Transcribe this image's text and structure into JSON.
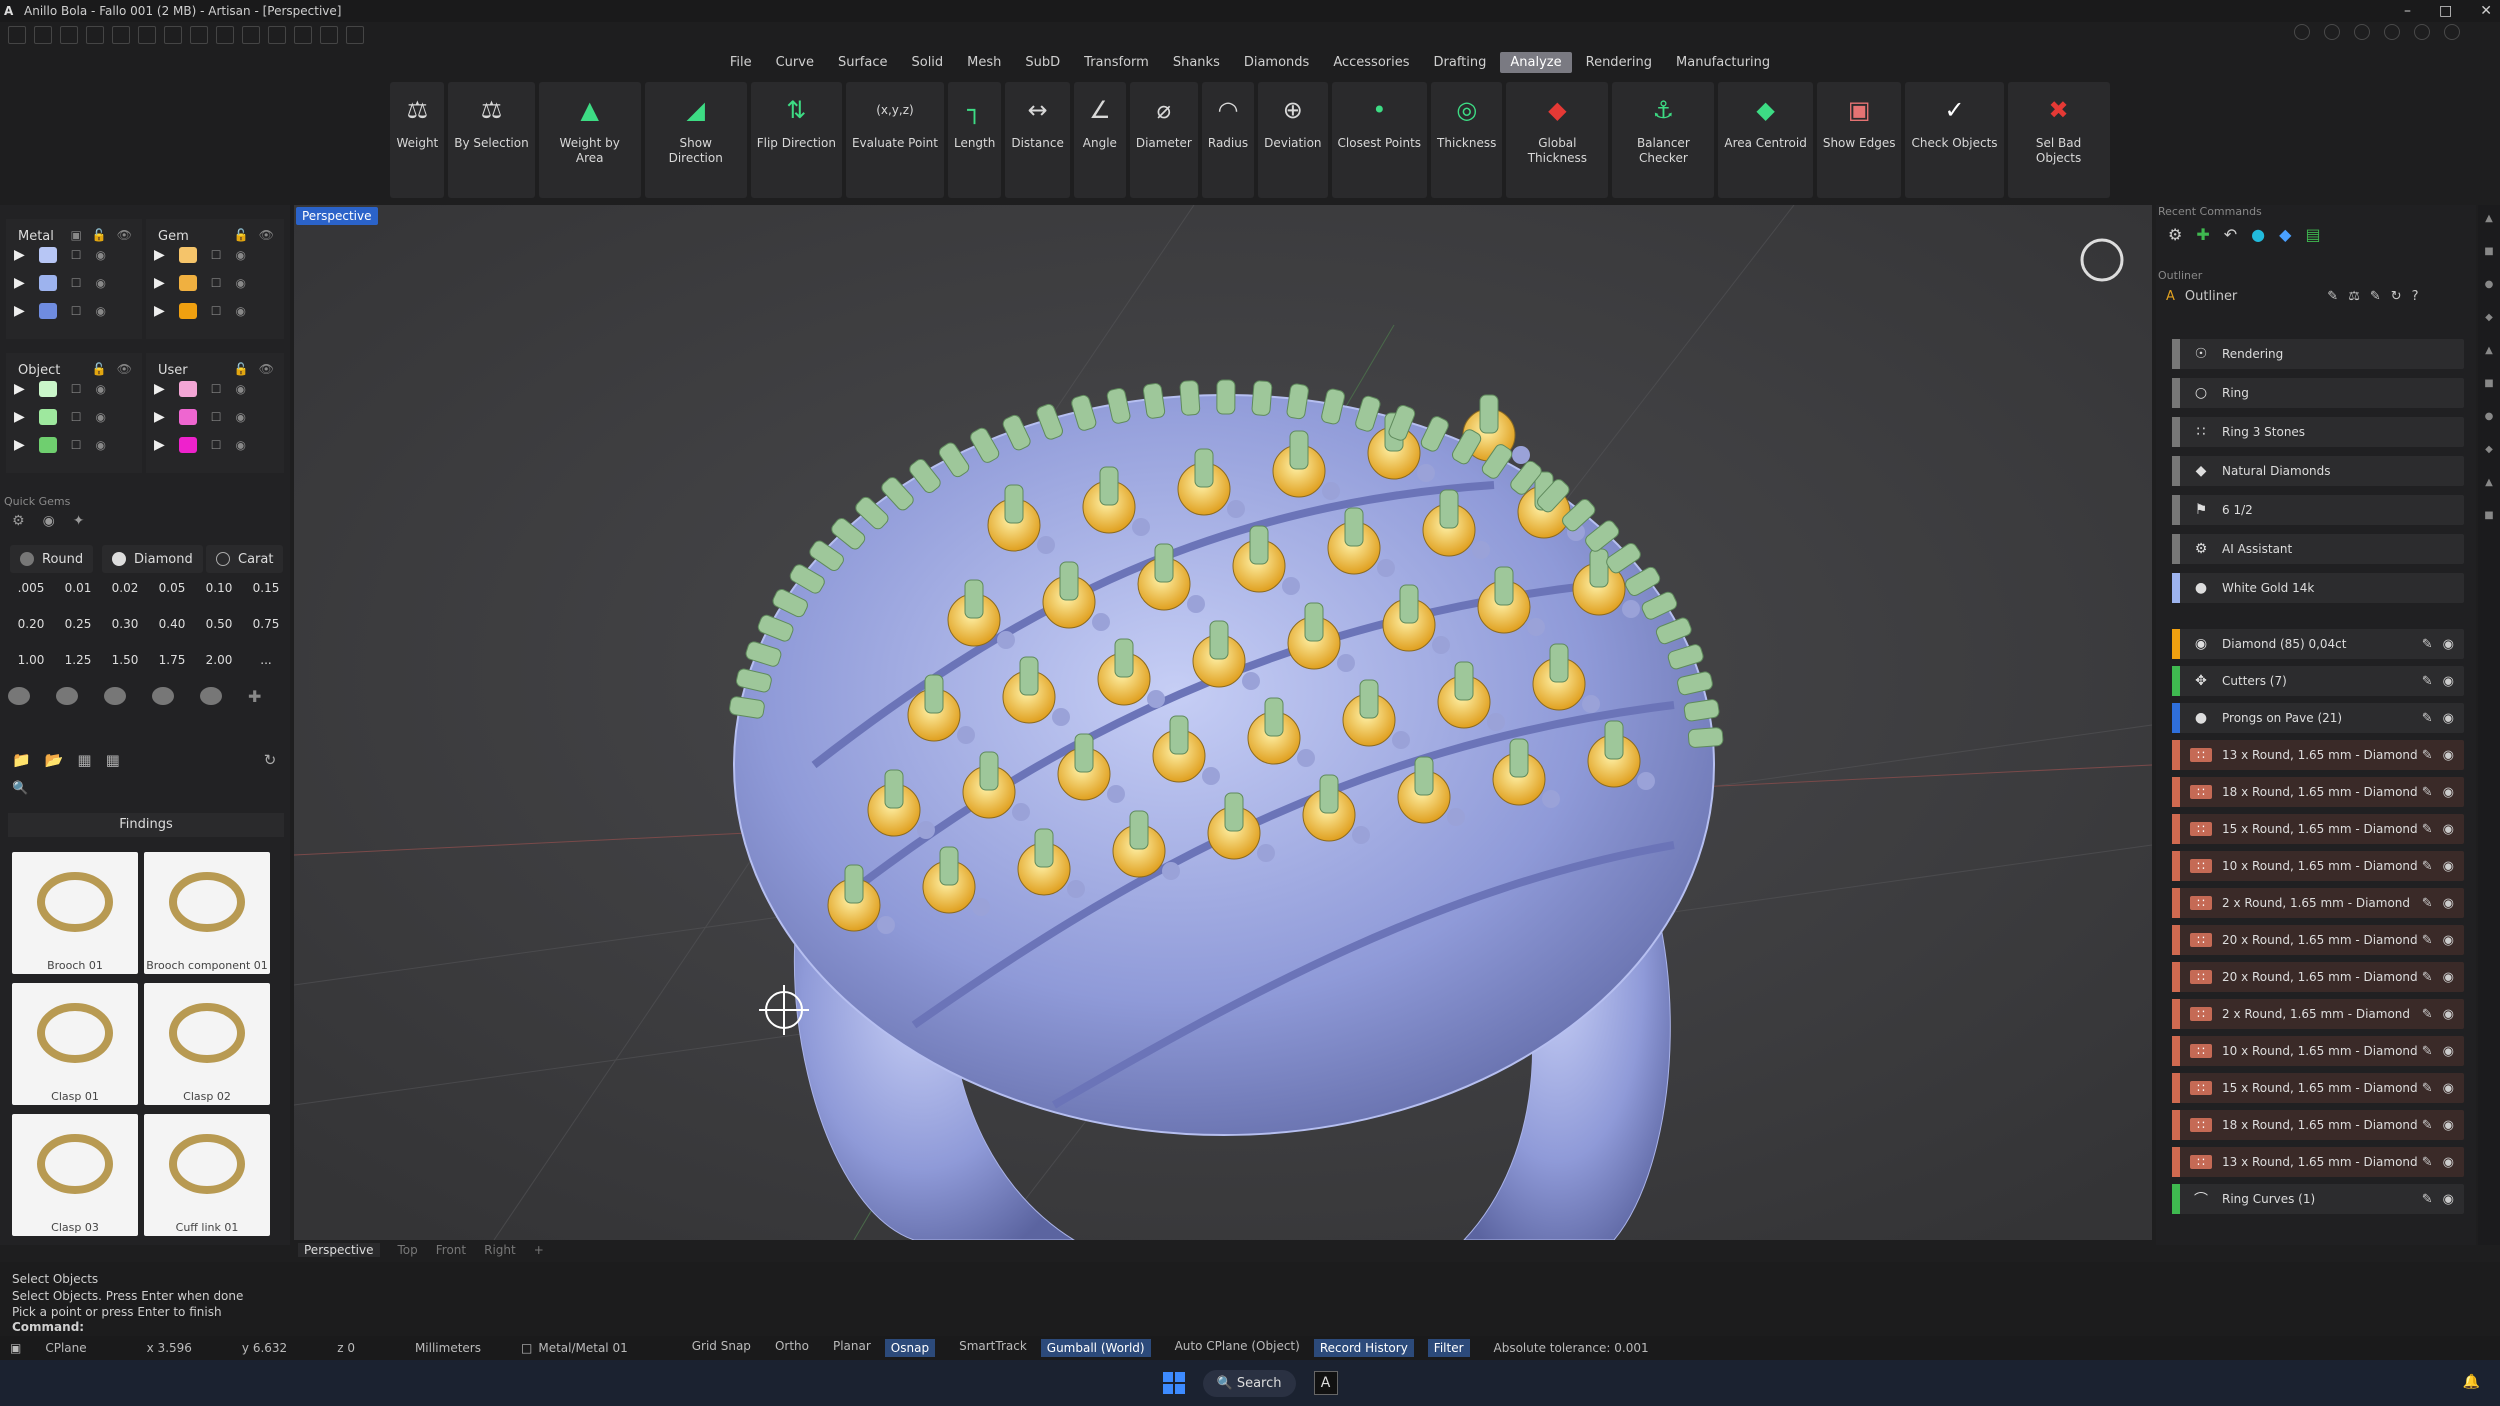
{
  "window": {
    "title": "Anillo Bola - Fallo 001 (2 MB) - Artisan - [Perspective]",
    "min": "–",
    "max": "□",
    "close": "✕"
  },
  "menu": [
    "File",
    "Curve",
    "Surface",
    "Solid",
    "Mesh",
    "SubD",
    "Transform",
    "Shanks",
    "Diamonds",
    "Accessories",
    "Drafting",
    "Analyze",
    "Rendering",
    "Manufacturing"
  ],
  "menu_active": "Analyze",
  "ribbon": [
    {
      "label": "Weight",
      "icon": "⚖",
      "color": "#d8d8d8"
    },
    {
      "label": "By Selection",
      "icon": "⚖",
      "color": "#d8d8d8"
    },
    {
      "label": "Weight by Area",
      "icon": "▲",
      "color": "#3ddc84"
    },
    {
      "label": "Show Direction",
      "icon": "◢",
      "color": "#3ddc84"
    },
    {
      "label": "Flip Direction",
      "icon": "⇅",
      "color": "#3ddc84"
    },
    {
      "label": "Evaluate Point",
      "icon": "(x,y,z)",
      "color": "#d8d8d8"
    },
    {
      "label": "Length",
      "icon": "┐",
      "color": "#3ddc84"
    },
    {
      "label": "Distance",
      "icon": "↔",
      "color": "#d8d8d8"
    },
    {
      "label": "Angle",
      "icon": "∠",
      "color": "#d8d8d8"
    },
    {
      "label": "Diameter",
      "icon": "⌀",
      "color": "#d8d8d8"
    },
    {
      "label": "Radius",
      "icon": "◠",
      "color": "#d8d8d8"
    },
    {
      "label": "Deviation",
      "icon": "⊕",
      "color": "#d8d8d8"
    },
    {
      "label": "Closest Points",
      "icon": "•",
      "color": "#3ddc84"
    },
    {
      "label": "Thickness",
      "icon": "◎",
      "color": "#3ddc84"
    },
    {
      "label": "Global Thickness",
      "icon": "◆",
      "color": "#e53935"
    },
    {
      "label": "Balancer Checker",
      "icon": "⚓",
      "color": "#3ddc84"
    },
    {
      "label": "Area Centroid",
      "icon": "◆",
      "color": "#3ddc84"
    },
    {
      "label": "Show Edges",
      "icon": "▣",
      "color": "#e57373"
    },
    {
      "label": "Check Objects",
      "icon": "✓",
      "color": "#ffffff"
    },
    {
      "label": "Sel Bad Objects",
      "icon": "✖",
      "color": "#e53935"
    }
  ],
  "layers": {
    "metal": {
      "title": "Metal",
      "colors": [
        "#b7c6f5",
        "#9db3ee",
        "#6f8ce0"
      ]
    },
    "gem": {
      "title": "Gem",
      "colors": [
        "#f5c46a",
        "#f0b040",
        "#f0a010"
      ]
    },
    "object": {
      "title": "Object",
      "colors": [
        "#c9f5c9",
        "#9ee89e",
        "#6fcf6f"
      ]
    },
    "user": {
      "title": "User",
      "colors": [
        "#f3a6d5",
        "#ee66d0",
        "#ee22cc"
      ]
    }
  },
  "quick_gems": {
    "title": "Quick Gems",
    "shape": "Round",
    "material": "Diamond",
    "unit": "Carat",
    "sizes": [
      ".005",
      "0.01",
      "0.02",
      "0.05",
      "0.10",
      "0.15",
      "0.20",
      "0.25",
      "0.30",
      "0.40",
      "0.50",
      "0.75",
      "1.00",
      "1.25",
      "1.50",
      "1.75",
      "2.00",
      "..."
    ]
  },
  "findings": {
    "title": "Findings",
    "items": [
      "Brooch 01",
      "Brooch component 01",
      "Clasp 01",
      "Clasp 02",
      "Clasp 03",
      "Cuff link 01"
    ]
  },
  "viewport": {
    "label": "Perspective",
    "tabs": [
      "Perspective",
      "Top",
      "Front",
      "Right",
      "+"
    ]
  },
  "right_panel": {
    "recent_title": "Recent Commands",
    "outliner_title": "Outliner",
    "outliner_label": "Outliner",
    "rows": [
      {
        "label": "Rendering",
        "icon": "☉",
        "bar": "#777777"
      },
      {
        "label": "Ring",
        "icon": "○",
        "bar": "#777777"
      },
      {
        "label": "Ring 3 Stones",
        "icon": "∷",
        "bar": "#777777"
      },
      {
        "label": "Natural Diamonds",
        "icon": "◆",
        "bar": "#777777"
      },
      {
        "label": "6 1/2",
        "icon": "⚑",
        "bar": "#777777"
      },
      {
        "label": "AI Assistant",
        "icon": "⚙",
        "bar": "#777777"
      },
      {
        "label": "White Gold 14k",
        "icon": "●",
        "bar": "#9db3ee"
      },
      {
        "label": "Diamond (85) 0,04ct",
        "icon": "◉",
        "bar": "#f0a010"
      },
      {
        "label": "Cutters (7)",
        "icon": "✥",
        "bar": "#3fb950"
      },
      {
        "label": "Prongs on Pave (21)",
        "icon": "●",
        "bar": "#2f6fdb"
      },
      {
        "label": "13 x Round, 1.65 mm - Diamond",
        "icon": "∷",
        "bar": "#d06a50"
      },
      {
        "label": "18 x Round, 1.65 mm - Diamond",
        "icon": "∷",
        "bar": "#d06a50"
      },
      {
        "label": "15 x Round, 1.65 mm - Diamond",
        "icon": "∷",
        "bar": "#d06a50"
      },
      {
        "label": "10 x Round, 1.65 mm - Diamond",
        "icon": "∷",
        "bar": "#d06a50"
      },
      {
        "label": "2 x Round, 1.65 mm - Diamond",
        "icon": "∷",
        "bar": "#d06a50"
      },
      {
        "label": "20 x Round, 1.65 mm - Diamond",
        "icon": "∷",
        "bar": "#d06a50"
      },
      {
        "label": "20 x Round, 1.65 mm - Diamond",
        "icon": "∷",
        "bar": "#d06a50"
      },
      {
        "label": "2 x Round, 1.65 mm - Diamond",
        "icon": "∷",
        "bar": "#d06a50"
      },
      {
        "label": "10 x Round, 1.65 mm - Diamond",
        "icon": "∷",
        "bar": "#d06a50"
      },
      {
        "label": "15 x Round, 1.65 mm - Diamond",
        "icon": "∷",
        "bar": "#d06a50"
      },
      {
        "label": "18 x Round, 1.65 mm - Diamond",
        "icon": "∷",
        "bar": "#d06a50"
      },
      {
        "label": "13 x Round, 1.65 mm - Diamond",
        "icon": "∷",
        "bar": "#d06a50"
      },
      {
        "label": "Ring Curves (1)",
        "icon": "⌒",
        "bar": "#3fb950"
      }
    ]
  },
  "command": {
    "lines": [
      "Select Objects",
      "Select Objects. Press Enter when done",
      "Pick a point or press Enter to finish"
    ],
    "prompt": "Command:"
  },
  "status": {
    "cplane": "CPlane",
    "x": "x 3.596",
    "y": "y 6.632",
    "z": "z 0",
    "units": "Millimeters",
    "layer": "Metal/Metal 01",
    "toggles": [
      "Grid Snap",
      "Ortho",
      "Planar",
      "Osnap",
      "SmartTrack",
      "Gumball (World)",
      "Auto CPlane (Object)",
      "Record History",
      "Filter"
    ],
    "active_toggles": [
      "Osnap",
      "Gumball (World)",
      "Record History",
      "Filter"
    ],
    "tolerance": "Absolute tolerance: 0.001"
  },
  "taskbar": {
    "search": "Search"
  }
}
